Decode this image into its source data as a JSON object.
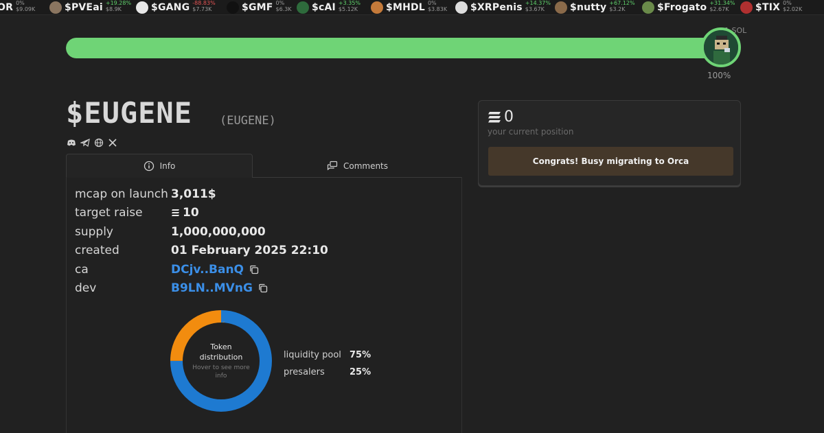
{
  "ticker": [
    {
      "sym": "OR",
      "change": "0%",
      "change_dir": "flat",
      "mcap": "$9.09K",
      "avatar_color": "#555555"
    },
    {
      "sym": "$PVEai",
      "change": "+19.28%",
      "change_dir": "up",
      "mcap": "$8.9K",
      "avatar_color": "#8a7560"
    },
    {
      "sym": "$GANG",
      "change": "-88.83%",
      "change_dir": "down",
      "mcap": "$7.73K",
      "avatar_color": "#e8e8e8"
    },
    {
      "sym": "$GMF",
      "change": "0%",
      "change_dir": "flat",
      "mcap": "$6.3K",
      "avatar_color": "#111111"
    },
    {
      "sym": "$cAI",
      "change": "+3.35%",
      "change_dir": "up",
      "mcap": "$5.12K",
      "avatar_color": "#2e6b3c"
    },
    {
      "sym": "$MHDL",
      "change": "0%",
      "change_dir": "flat",
      "mcap": "$3.83K",
      "avatar_color": "#c47a3a"
    },
    {
      "sym": "$XRPenis",
      "change": "+14.37%",
      "change_dir": "up",
      "mcap": "$3.67K",
      "avatar_color": "#dddddd"
    },
    {
      "sym": "$nutty",
      "change": "+67.12%",
      "change_dir": "up",
      "mcap": "$3.2K",
      "avatar_color": "#8a6a4a"
    },
    {
      "sym": "$Frogato",
      "change": "+31.34%",
      "change_dir": "up",
      "mcap": "$2.67K",
      "avatar_color": "#6a8a4a"
    },
    {
      "sym": "$TIX",
      "change": "0%",
      "change_dir": "flat",
      "mcap": "$2.02K",
      "avatar_color": "#b03030"
    }
  ],
  "progress": {
    "percent_label": "100%",
    "fill_fraction": 1.0,
    "corner_label": "1 SOL"
  },
  "token": {
    "name": "$EUGENE",
    "ticker": "(EUGENE)"
  },
  "socials": [
    "discord-icon",
    "telegram-icon",
    "globe-icon",
    "x-icon"
  ],
  "tabs": [
    {
      "label": "Info",
      "icon": "info-icon",
      "active": true
    },
    {
      "label": "Comments",
      "icon": "comments-icon",
      "active": false
    }
  ],
  "info": {
    "mcap_label": "mcap on launch",
    "mcap_value": "3,011$",
    "target_label": "target raise",
    "target_value": "10",
    "supply_label": "supply",
    "supply_value": "1,000,000,000",
    "created_label": "created",
    "created_value": "01 February 2025 22:10",
    "ca_label": "ca",
    "ca_value": "DCjv..BanQ",
    "dev_label": "dev",
    "dev_value": "B9LN..MVnG"
  },
  "distribution": {
    "title": "Token distribution",
    "hint": "Hover to see more info",
    "slices": [
      {
        "name": "liquidity pool",
        "value": 75,
        "label": "75%",
        "color": "#1e7ad1"
      },
      {
        "name": "presalers",
        "value": 25,
        "label": "25%",
        "color": "#f28c0f"
      }
    ]
  },
  "position": {
    "amount": "0",
    "subtitle": "your current position",
    "status_button": "Congrats! Busy migrating to Orca"
  }
}
